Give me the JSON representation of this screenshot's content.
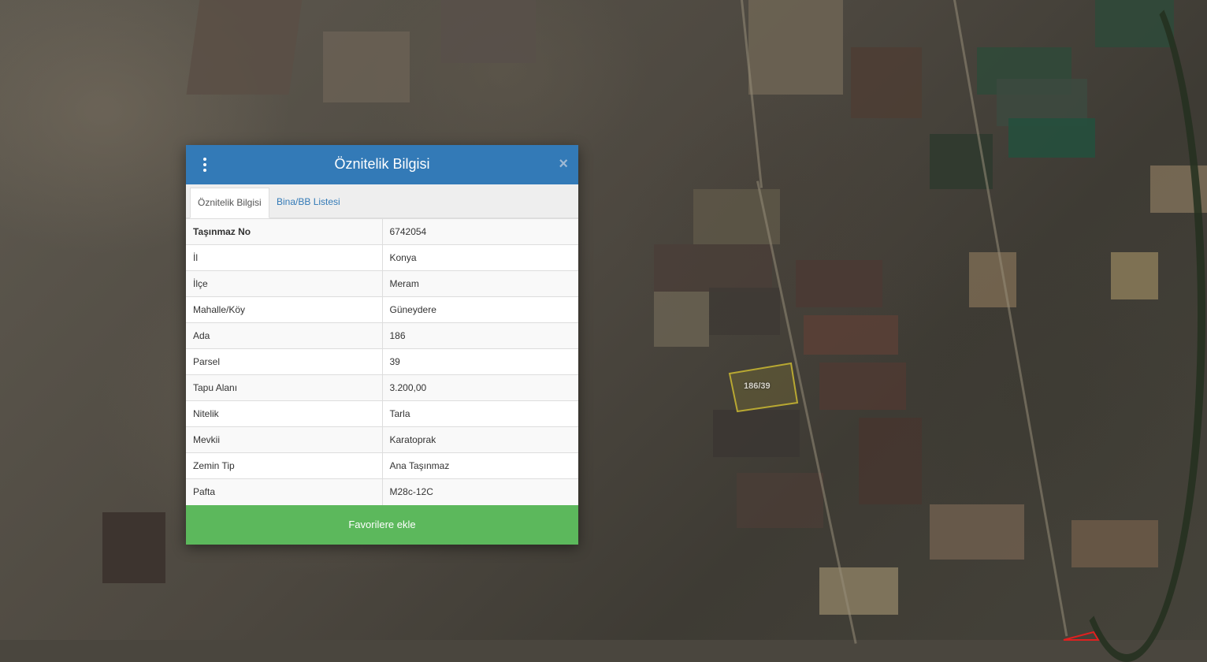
{
  "dialog": {
    "title": "Öznitelik Bilgisi",
    "menu_icon": "more-vertical-icon",
    "close_icon": "close-icon",
    "close_label": "×",
    "tabs": [
      {
        "label": "Öznitelik Bilgisi",
        "active": true
      },
      {
        "label": "Bina/BB Listesi",
        "active": false
      }
    ],
    "rows": [
      {
        "key": "Taşınmaz No",
        "value": "6742054"
      },
      {
        "key": "İl",
        "value": "Konya"
      },
      {
        "key": "İlçe",
        "value": "Meram"
      },
      {
        "key": "Mahalle/Köy",
        "value": "Güneydere"
      },
      {
        "key": "Ada",
        "value": "186"
      },
      {
        "key": "Parsel",
        "value": "39"
      },
      {
        "key": "Tapu Alanı",
        "value": "3.200,00"
      },
      {
        "key": "Nitelik",
        "value": "Tarla"
      },
      {
        "key": "Mevkii",
        "value": "Karatoprak"
      },
      {
        "key": "Zemin Tip",
        "value": "Ana Taşınmaz"
      },
      {
        "key": "Pafta",
        "value": "M28c-12C"
      }
    ],
    "favorite_button": "Favorilere ekle"
  },
  "map": {
    "parcel_label": "186/39",
    "parcel_color": "#b8a832"
  },
  "colors": {
    "header": "#337ab7",
    "button": "#5cb85c"
  }
}
